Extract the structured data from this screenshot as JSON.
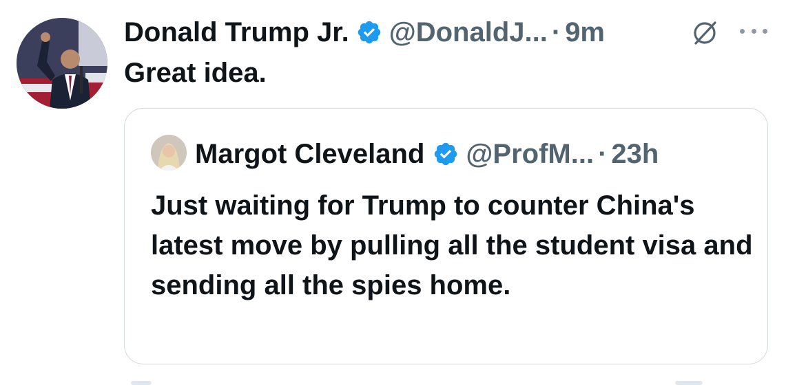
{
  "tweet": {
    "author_name": "Donald Trump Jr.",
    "handle": "@DonaldJ...",
    "separator": "·",
    "time": "9m",
    "text": "Great idea."
  },
  "quote": {
    "author_name": "Margot Cleveland",
    "handle": "@ProfM...",
    "separator": "·",
    "time": "23h",
    "text": "Just waiting for Trump to counter China's latest move by pulling all the student visa and sending all the spies home."
  },
  "icons": {
    "verified": "verified-badge-icon",
    "grok": "grok-icon",
    "more": "more-icon"
  },
  "colors": {
    "verified_blue": "#1d9bf0",
    "muted_text": "#536471",
    "border": "#cfd9de"
  }
}
